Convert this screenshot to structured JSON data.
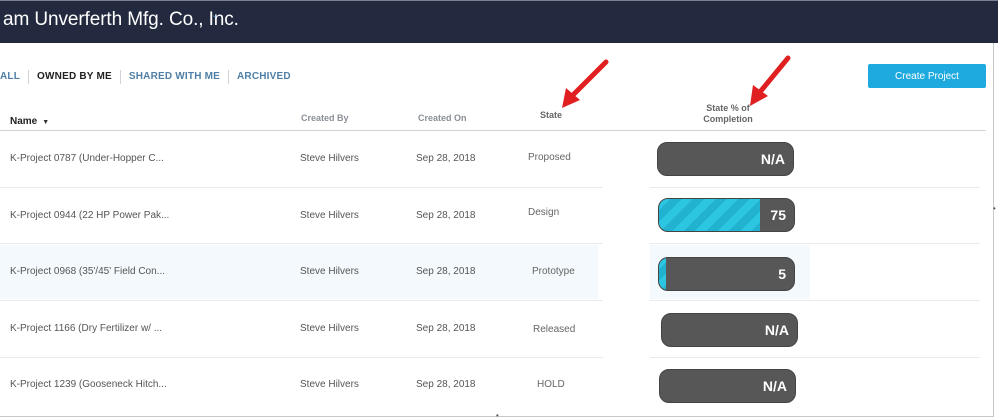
{
  "header": {
    "org_name": "am Unverferth Mfg. Co., Inc.",
    "org_caret": "ˇ"
  },
  "tabs": [
    {
      "label": "ALL",
      "active": false
    },
    {
      "label": "OWNED BY ME",
      "active": true
    },
    {
      "label": "SHARED WITH ME",
      "active": false
    },
    {
      "label": "ARCHIVED",
      "active": false
    }
  ],
  "toolbar": {
    "create_label": "Create Project"
  },
  "table": {
    "columns": {
      "name": "Name",
      "created_by": "Created By",
      "created_on": "Created On",
      "state": "State",
      "completion_line1": "State % of",
      "completion_line2": "Completion"
    },
    "rows": [
      {
        "name": "K-Project 0787 (Under-Hopper C...",
        "created_by": "Steve Hilvers",
        "created_on": "Sep 28, 2018",
        "state": "Proposed",
        "completion_label": "N/A",
        "completion_fraction": 0
      },
      {
        "name": "K-Project 0944 (22 HP Power Pak...",
        "created_by": "Steve Hilvers",
        "created_on": "Sep 28, 2018",
        "state": "Design",
        "completion_label": "75",
        "completion_fraction": 0.75
      },
      {
        "name": "K-Project 0968 (35'/45' Field Con...",
        "created_by": "Steve Hilvers",
        "created_on": "Sep 28, 2018",
        "state": "Prototype",
        "completion_label": "5",
        "completion_fraction": 0.05
      },
      {
        "name": "K-Project 1166 (Dry Fertilizer w/ ...",
        "created_by": "Steve Hilvers",
        "created_on": "Sep 28, 2018",
        "state": "Released",
        "completion_label": "N/A",
        "completion_fraction": 0
      },
      {
        "name": "K-Project 1239 (Gooseneck Hitch...",
        "created_by": "Steve Hilvers",
        "created_on": "Sep 28, 2018",
        "state": "HOLD",
        "completion_label": "N/A",
        "completion_fraction": 0
      }
    ]
  },
  "colors": {
    "topbar": "#232a40",
    "accent": "#1eaadf",
    "progress_fill": "#2cc6e2",
    "progress_track": "#575757",
    "annotation_arrow": "#e02020"
  }
}
